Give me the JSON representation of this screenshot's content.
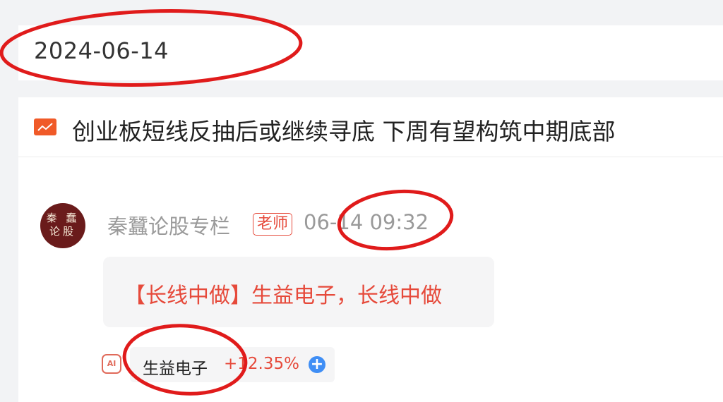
{
  "date_header": {
    "date": "2024-06-14"
  },
  "headline": {
    "icon": "trend-chart-icon",
    "title": "创业板短线反抽后或继续寻底 下周有望构筑中期底部"
  },
  "post": {
    "avatar_text_line1": "秦 蠢",
    "avatar_text_line2": "论股",
    "author": "秦蠶论股专栏",
    "badge": "老师",
    "timestamp": "06-14 09:32",
    "content": "【长线中做】生益电子，长线中做"
  },
  "stock_tag": {
    "ai_icon_label": "AI",
    "name": "生益电子",
    "change": "+12.35%",
    "add_icon": "+"
  },
  "colors": {
    "accent_red": "#e64a3b",
    "annotation_red": "#e01b1b",
    "add_blue": "#3f8ef5"
  }
}
